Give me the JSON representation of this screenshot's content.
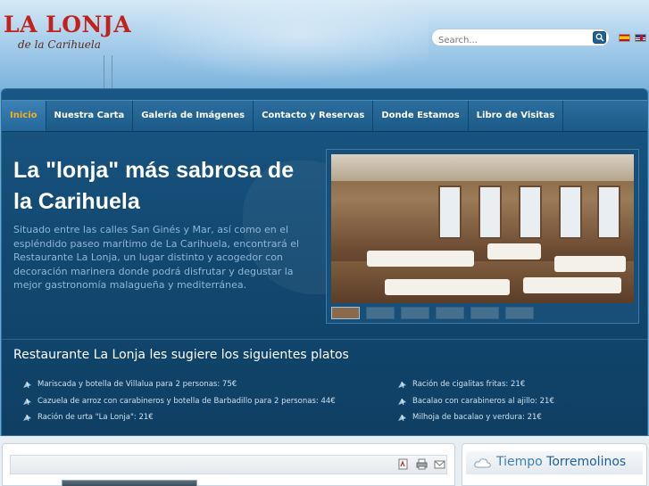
{
  "header": {
    "logo_line1": "LA LONJA",
    "logo_line2": "de la Carihuela",
    "search_placeholder": "Search...",
    "languages": [
      "Español",
      "English"
    ]
  },
  "nav": {
    "items": [
      {
        "label": "Inicio",
        "active": true
      },
      {
        "label": "Nuestra Carta",
        "active": false
      },
      {
        "label": "Galería de Imágenes",
        "active": false
      },
      {
        "label": "Contacto y Reservas",
        "active": false
      },
      {
        "label": "Donde Estamos",
        "active": false
      },
      {
        "label": "Libro de Visitas",
        "active": false
      }
    ]
  },
  "hero": {
    "title": "La \"lonja\" más sabrosa de la Carihuela",
    "text": "Situado entre las calles San Ginés y Mar, así como en el espléndido paseo marítimo de La Carihuela, encontrará el Restaurante La Lonja, un lugar distinto y acogedor con decoración marinera donde podrá disfrutar y degustar la mejor gastronomía malagueña y mediterránea."
  },
  "gallery": {
    "thumbnail_count": 6,
    "selected_index": 0
  },
  "suggestions": {
    "title": "Restaurante La Lonja les sugiere los siguientes platos",
    "left": [
      "Mariscada y botella de Villalua para 2 personas: 75€",
      "Cazuela de arroz con carabineros y botella de Barbadillo para 2 personas: 44€",
      "Ración de urta \"La Lonja\": 21€"
    ],
    "right": [
      "Ración de cigalitas fritas: 21€",
      "Bacalao con carabineros al ajillo: 21€",
      "Milhoja de bacalao y verdura: 21€"
    ]
  },
  "content": {
    "tools": [
      "pdf-icon",
      "print-icon",
      "email-icon"
    ]
  },
  "weather": {
    "label_a": "Tiempo",
    "label_b": "Torremolinos"
  },
  "colors": {
    "accent": "#f2b022",
    "brand_red": "#c2221c",
    "panel": "#134a73"
  }
}
